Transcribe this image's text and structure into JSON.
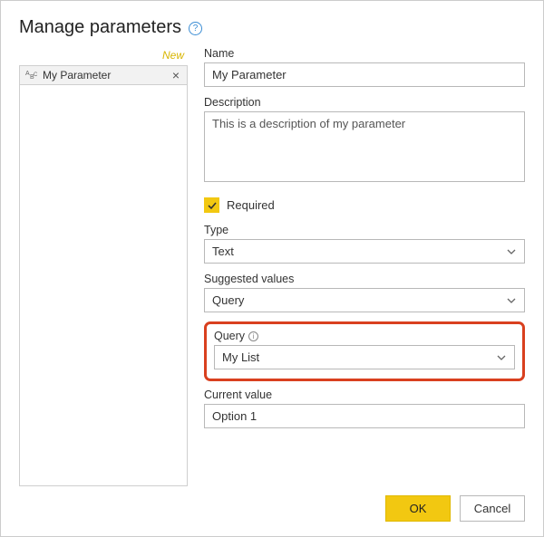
{
  "title": "Manage parameters",
  "new_link": "New",
  "sidebar": {
    "items": [
      {
        "label": "My Parameter"
      }
    ]
  },
  "form": {
    "name_label": "Name",
    "name_value": "My Parameter",
    "description_label": "Description",
    "description_value": "This is a description of my parameter",
    "required_label": "Required",
    "required_checked": true,
    "type_label": "Type",
    "type_value": "Text",
    "suggested_label": "Suggested values",
    "suggested_value": "Query",
    "query_label": "Query",
    "query_value": "My List",
    "current_label": "Current value",
    "current_value": "Option 1"
  },
  "footer": {
    "ok": "OK",
    "cancel": "Cancel"
  }
}
